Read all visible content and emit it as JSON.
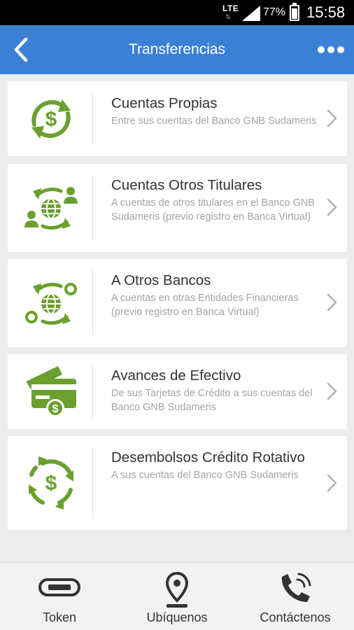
{
  "status_bar": {
    "network": "LTE",
    "battery_percent": "77%",
    "battery_level": 0.77,
    "time": "15:58"
  },
  "header": {
    "title": "Transferencias",
    "back_icon": "chevron-left-icon",
    "more_icon": "more-dots-icon"
  },
  "colors": {
    "header_bg": "#3c80d6",
    "icon_green": "#6aa12e",
    "chevron": "#b0b0b0"
  },
  "items": [
    {
      "title": "Cuentas Propias",
      "subtitle": "Entre sus cuentas del Banco GNB Sudameris",
      "icon": "dollar-cycle-icon"
    },
    {
      "title": "Cuentas Otros Titulares",
      "subtitle": "A cuentas de otros titulares en el Banco GNB Sudameris (previo registro en Banca Virtual)",
      "icon": "globe-users-transfer-icon"
    },
    {
      "title": "A Otros Bancos",
      "subtitle": "A cuentas en otras Entidades Financieras (previo registro en Banca Virtual)",
      "icon": "globe-banks-transfer-icon"
    },
    {
      "title": "Avances de Efectivo",
      "subtitle": "De sus Tarjetas de Crédito a sus cuentas del Banco GNB Sudameris",
      "icon": "credit-card-dollar-icon"
    },
    {
      "title": "Desembolsos Crédito Rotativo",
      "subtitle": "A sus cuentas del Banco GNB Sudameris",
      "icon": "dollar-rotate-icon"
    }
  ],
  "tabs": [
    {
      "label": "Token",
      "icon": "token-icon"
    },
    {
      "label": "Ubíquenos",
      "icon": "location-pin-icon"
    },
    {
      "label": "Contáctenos",
      "icon": "phone-icon"
    }
  ]
}
